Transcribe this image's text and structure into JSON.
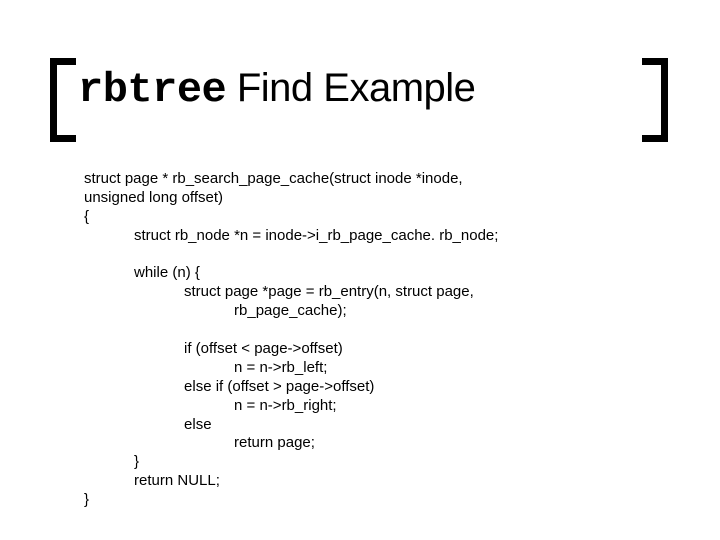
{
  "title": {
    "mono": "rbtree",
    "rest": " Find Example"
  },
  "code": {
    "l01": "struct page * rb_search_page_cache(struct inode *inode,",
    "l02": "unsigned long offset)",
    "l03": "{",
    "l04": "            struct rb_node *n = inode->i_rb_page_cache. rb_node;",
    "l05": "",
    "l06": "            while (n) {",
    "l07": "                        struct page *page = rb_entry(n, struct page,",
    "l08": "                                    rb_page_cache);",
    "l09": "",
    "l10": "                        if (offset < page->offset)",
    "l11": "                                    n = n->rb_left;",
    "l12": "                        else if (offset > page->offset)",
    "l13": "                                    n = n->rb_right;",
    "l14": "                        else",
    "l15": "                                    return page;",
    "l16": "            }",
    "l17": "            return NULL;",
    "l18": "}"
  }
}
